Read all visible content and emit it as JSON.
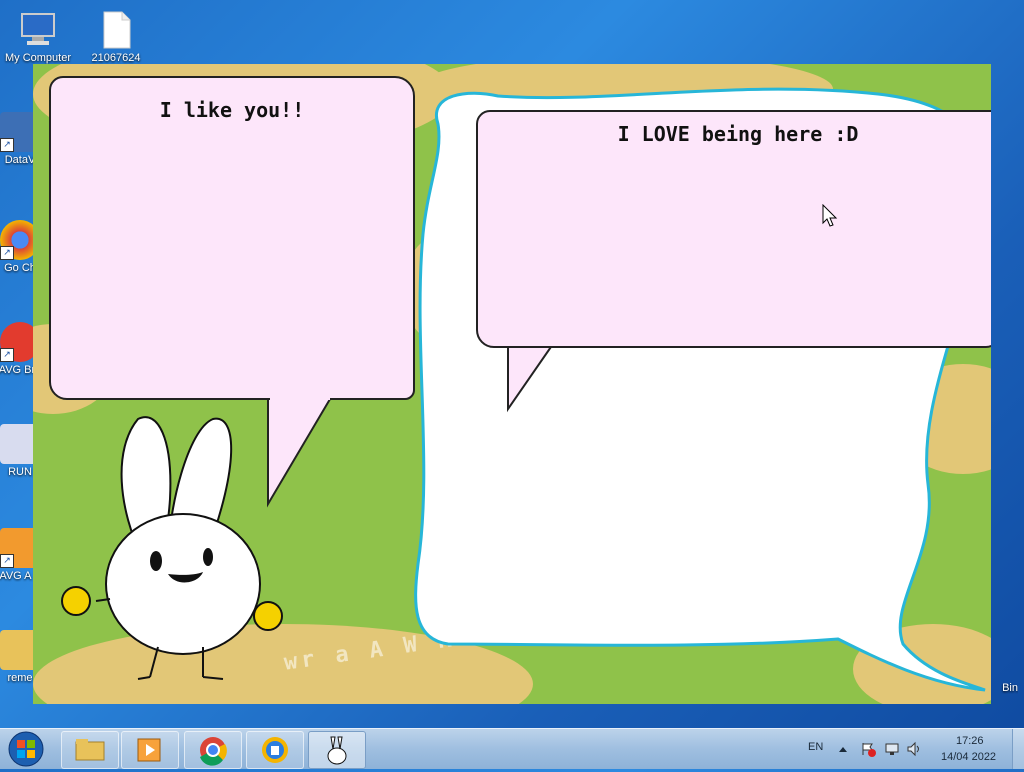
{
  "desktop": {
    "icons": [
      {
        "label": "My Computer",
        "icon": "computer-icon"
      },
      {
        "label": "21067624",
        "icon": "file-icon"
      },
      {
        "label": "DataV",
        "icon": "app-shortcut-icon"
      },
      {
        "label": "Go Ch",
        "icon": "chrome-shortcut-icon"
      },
      {
        "label": "AVG Bro",
        "icon": "avg-browser-shortcut-icon"
      },
      {
        "label": "RUN",
        "icon": "bunny-app-icon"
      },
      {
        "label": "AVG A F",
        "icon": "avg-antivirus-shortcut-icon"
      },
      {
        "label": "reme",
        "icon": "folder-icon"
      },
      {
        "label": "Bin",
        "icon": "recycle-bin-icon"
      }
    ]
  },
  "app": {
    "left_bubble_text": "I like you!!",
    "right_bubble_text": "I LOVE being here :D",
    "background_watermark": "wr a A W R I N"
  },
  "taskbar": {
    "start": "start-orb-icon",
    "pinned": [
      "file-explorer-icon",
      "media-player-icon",
      "chrome-icon",
      "avg-secure-browser-icon",
      "bunny-app-icon"
    ],
    "language": "EN",
    "time": "17:26",
    "date": "14/04 2022"
  },
  "colors": {
    "bubble_pink": "#fde6fa",
    "grass_green": "#8fc24a",
    "sand": "#e2c777",
    "cloud_outline": "#27b6d8"
  }
}
